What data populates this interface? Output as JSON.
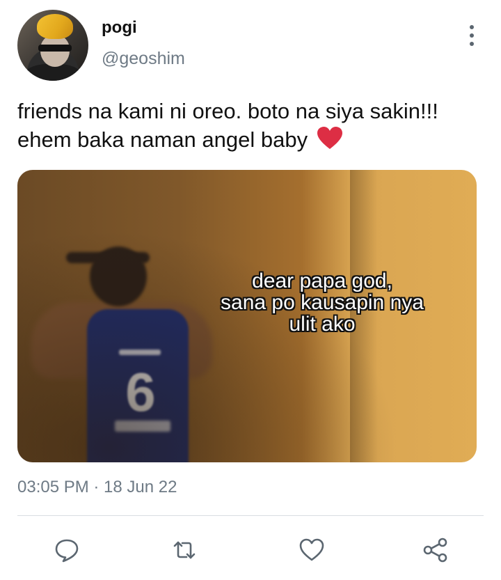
{
  "tweet": {
    "display_name": "pogi",
    "handle": "@geoshim",
    "text": "friends na kami ni oreo. boto na siya sakin!!! ehem baka naman angel baby",
    "emoji": "red-heart",
    "timestamp": "03:05 PM · 18 Jun 22"
  },
  "media": {
    "caption_line1": "dear papa god,",
    "caption_line2": "sana po kausapin nya",
    "caption_line3": "ulit ako",
    "jersey_number": "6"
  },
  "actions": {
    "reply_icon": "reply-icon",
    "retweet_icon": "retweet-icon",
    "like_icon": "heart-icon",
    "share_icon": "share-icon"
  },
  "colors": {
    "secondary_text": "#6e7a85",
    "icon": "#5b6670",
    "heart": "#dd2e44"
  }
}
